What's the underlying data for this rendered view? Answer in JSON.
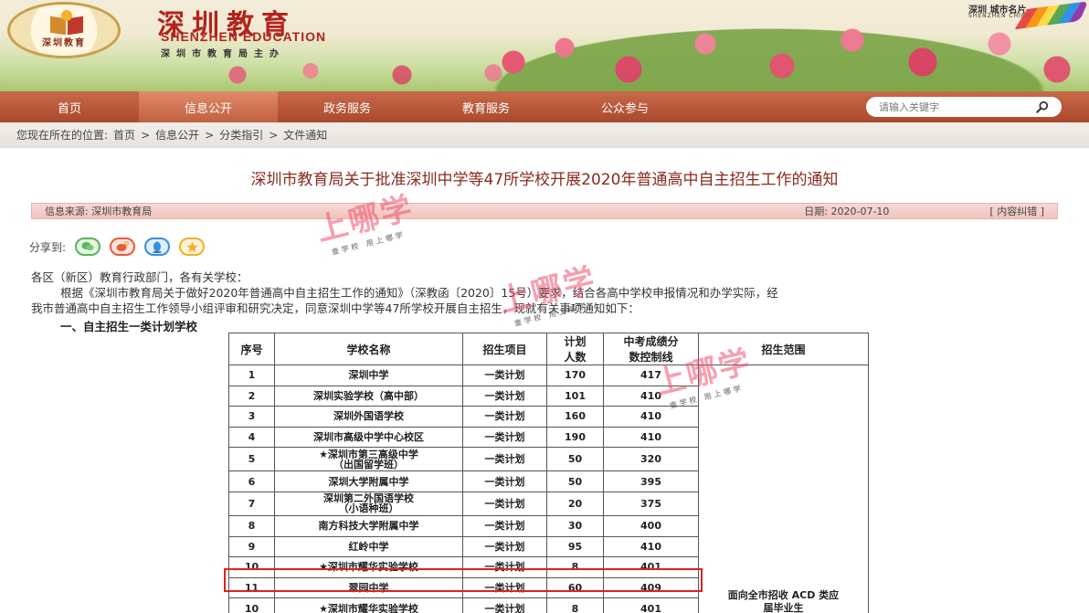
{
  "header": {
    "site_title": "深圳教育",
    "site_subtitle": "SHENZHEN EDUCATION",
    "organizer": "深圳市教育局主办",
    "emblem_caption": "深圳教育",
    "city_logo_cn": "深圳 城市名片",
    "city_logo_en": "SHENZHEN CHINA"
  },
  "nav": {
    "items": [
      {
        "label": "首页"
      },
      {
        "label": "信息公开"
      },
      {
        "label": "政务服务"
      },
      {
        "label": "教育服务"
      },
      {
        "label": "公众参与"
      }
    ],
    "active_index": 1,
    "search_placeholder": "请输入关键字"
  },
  "breadcrumb": {
    "prefix": "您现在所在的位置:",
    "items": [
      "首页",
      "信息公开",
      "分类指引",
      "文件通知"
    ],
    "separator": ">"
  },
  "article": {
    "title": "深圳市教育局关于批准深圳中学等47所学校开展2020年普通高中自主招生工作的通知",
    "source": "信息来源: 深圳市教育局",
    "date": "日期: 2020-07-10",
    "report": "[ 内容纠错 ]",
    "share_label": "分享到:",
    "greeting": "各区（新区）教育行政部门，各有关学校：",
    "body_line1": "根据《深圳市教育局关于做好2020年普通高中自主招生工作的通知》（深教函〔2020〕15号）要求，结合各高中学校申报情况和办学实际，经",
    "body_line2": "我市普通高中自主招生工作领导小组评审和研究决定，同意深圳中学等47所学校开展自主招生，现就有关事项通知如下：",
    "section1": "一、自主招生一类计划学校"
  },
  "watermark": {
    "brand": "上哪学",
    "slogan": "查学校 用上哪学"
  },
  "table": {
    "headers": {
      "no": "序号",
      "school": "学校名称",
      "item": "招生项目",
      "plan1": "计划",
      "plan2": "人数",
      "score1": "中考成绩分",
      "score2": "数控制线",
      "scope": "招生范围"
    },
    "rows": [
      {
        "no": "1",
        "school": "深圳中学",
        "school2": "",
        "item": "一类计划",
        "plan": "170",
        "score": "417"
      },
      {
        "no": "2",
        "school": "深圳实验学校（高中部）",
        "school2": "",
        "item": "一类计划",
        "plan": "101",
        "score": "410"
      },
      {
        "no": "3",
        "school": "深圳外国语学校",
        "school2": "",
        "item": "一类计划",
        "plan": "160",
        "score": "410"
      },
      {
        "no": "4",
        "school": "深圳市高级中学中心校区",
        "school2": "",
        "item": "一类计划",
        "plan": "190",
        "score": "410"
      },
      {
        "no": "5",
        "school": "★深圳市第三高级中学",
        "school2": "（出国留学班）",
        "item": "一类计划",
        "plan": "50",
        "score": "320"
      },
      {
        "no": "6",
        "school": "深圳大学附属中学",
        "school2": "",
        "item": "一类计划",
        "plan": "50",
        "score": "395"
      },
      {
        "no": "7",
        "school": "深圳第二外国语学校",
        "school2": "（小语种班）",
        "item": "一类计划",
        "plan": "20",
        "score": "375"
      },
      {
        "no": "8",
        "school": "南方科技大学附属中学",
        "school2": "",
        "item": "一类计划",
        "plan": "30",
        "score": "400"
      },
      {
        "no": "9",
        "school": "红岭中学",
        "school2": "",
        "item": "一类计划",
        "plan": "95",
        "score": "410"
      },
      {
        "no": "10",
        "school": "★深圳市耀华实验学校",
        "school2": "",
        "item": "一类计划",
        "plan": "8",
        "score": "401"
      },
      {
        "no": "11",
        "school": "翠园中学",
        "school2": "",
        "item": "一类计划",
        "plan": "60",
        "score": "409"
      },
      {
        "no": "10",
        "school": "★深圳市耀华实验学校",
        "school2": "",
        "item": "一类计划",
        "plan": "8",
        "score": "401"
      }
    ],
    "scope_line1": "面向全市招收 ACD 类应",
    "scope_line2": "届毕业生",
    "highlighted_row": 10
  },
  "colors": {
    "nav_bg": "#a94a2c",
    "title_red": "#b3231e",
    "article_title": "#8a2a1c",
    "highlight": "#e02020"
  }
}
